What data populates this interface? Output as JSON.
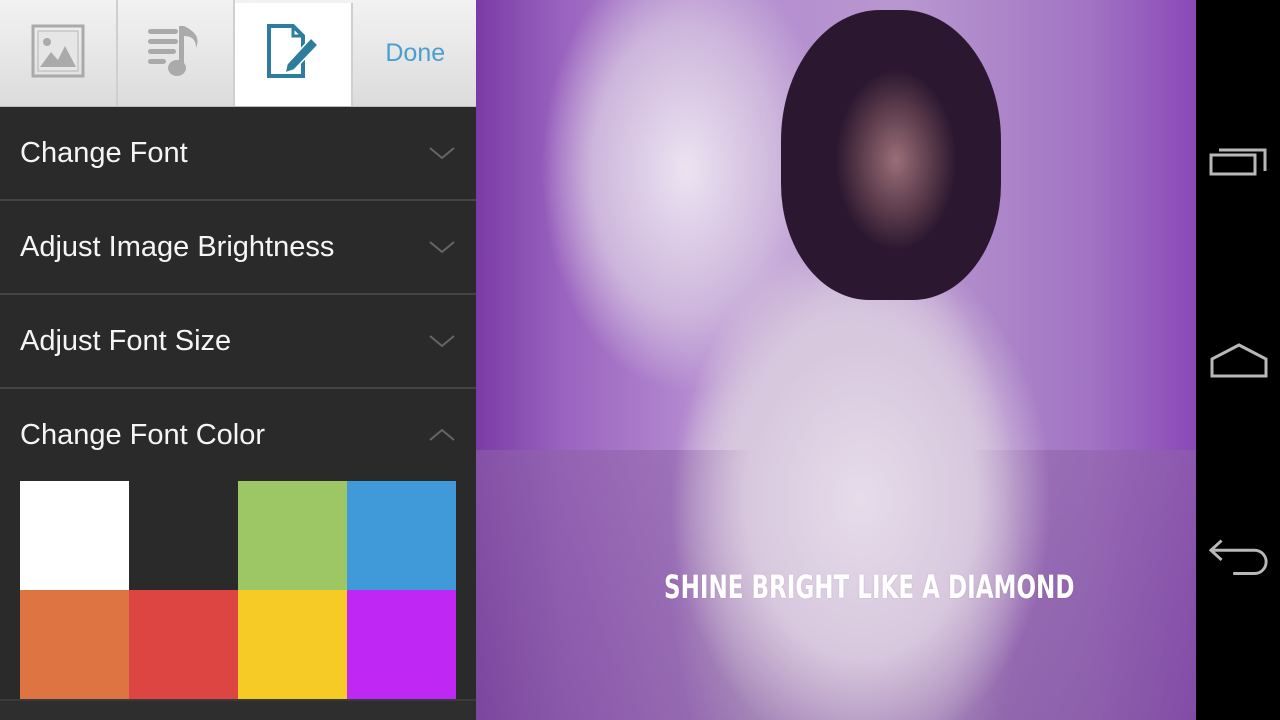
{
  "toolbar": {
    "buttons": [
      {
        "name": "image",
        "icon": "image-icon",
        "active": false
      },
      {
        "name": "lyrics",
        "icon": "music-lyrics-icon",
        "active": false
      },
      {
        "name": "edit",
        "icon": "edit-document-icon",
        "active": true
      }
    ],
    "done_label": "Done",
    "accent_color": "#4a9fd0"
  },
  "menu": {
    "items": [
      {
        "label": "Change Font",
        "expanded": false
      },
      {
        "label": "Adjust Image Brightness",
        "expanded": false
      },
      {
        "label": "Adjust Font Size",
        "expanded": false
      },
      {
        "label": "Change Font Color",
        "expanded": true
      }
    ]
  },
  "font_colors": [
    {
      "name": "white",
      "hex": "#ffffff"
    },
    {
      "name": "black",
      "hex": "#2a2a2a"
    },
    {
      "name": "green",
      "hex": "#9dc764"
    },
    {
      "name": "blue",
      "hex": "#409ad9"
    },
    {
      "name": "orange",
      "hex": "#de7441"
    },
    {
      "name": "red",
      "hex": "#dd4542"
    },
    {
      "name": "yellow",
      "hex": "#f6cb26"
    },
    {
      "name": "purple",
      "hex": "#bf27f5"
    }
  ],
  "canvas": {
    "caption": "SHINE BRIGHT LIKE A DIAMOND",
    "caption_color": "#ffffff"
  },
  "navbar": {
    "buttons": [
      "recent-apps",
      "home",
      "back"
    ]
  }
}
